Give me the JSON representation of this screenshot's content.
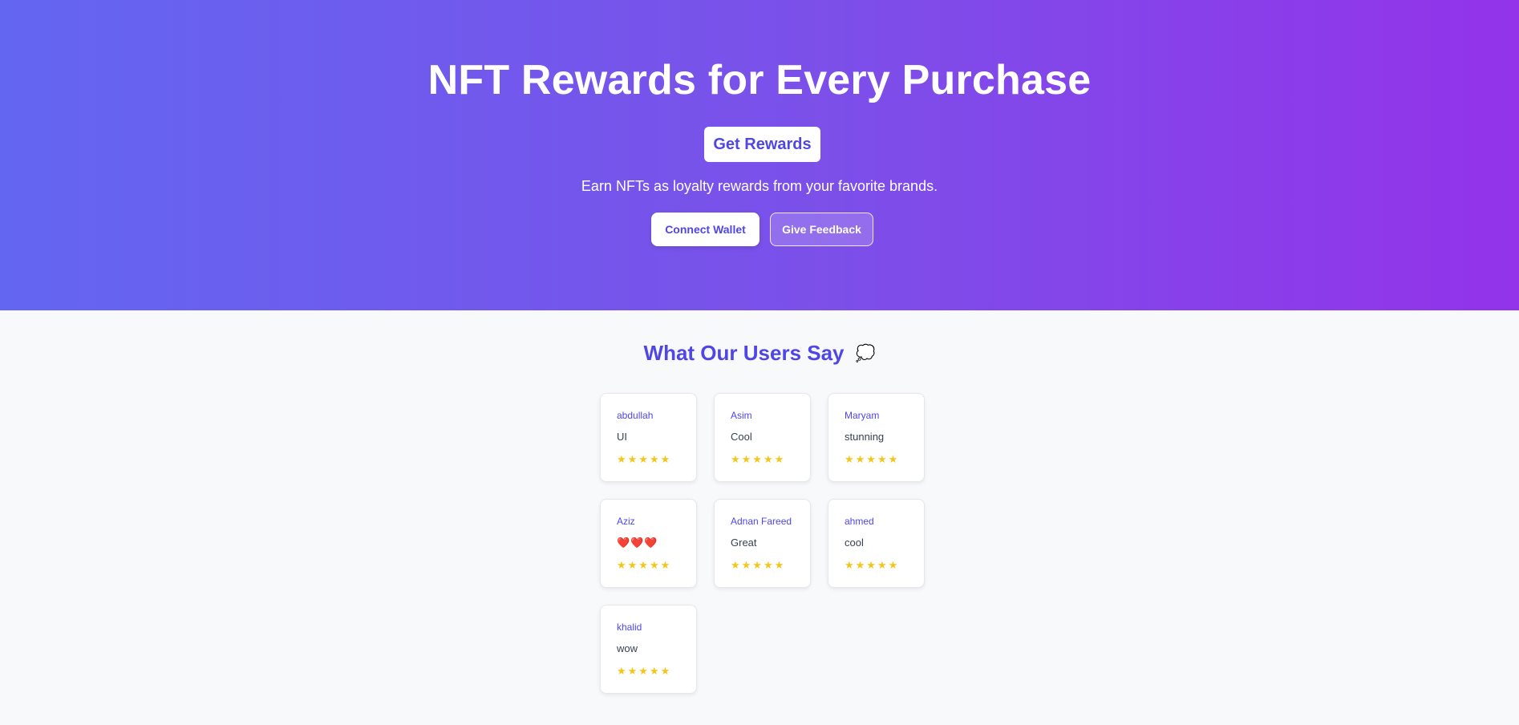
{
  "hero": {
    "title": "NFT Rewards for Every Purchase",
    "get_rewards_label": "Get Rewards",
    "subtitle": "Earn NFTs as loyalty rewards from your favorite brands.",
    "connect_wallet_label": "Connect Wallet",
    "give_feedback_label": "Give Feedback"
  },
  "testimonials": {
    "title": "What Our Users Say",
    "title_icon": "speech-bubble-icon",
    "title_icon_glyph": "💭",
    "reviews": [
      {
        "name": "abdullah",
        "comment": "UI",
        "rating": 5,
        "stars": "★★★★★"
      },
      {
        "name": "Asim",
        "comment": "Cool",
        "rating": 5,
        "stars": "★★★★★"
      },
      {
        "name": "Maryam",
        "comment": "stunning",
        "rating": 5,
        "stars": "★★★★★"
      },
      {
        "name": "Aziz",
        "comment": "❤️❤️❤️",
        "rating": 5,
        "stars": "★★★★★"
      },
      {
        "name": "Adnan Fareed",
        "comment": "Great",
        "rating": 5,
        "stars": "★★★★★"
      },
      {
        "name": "ahmed",
        "comment": "cool",
        "rating": 5,
        "stars": "★★★★★"
      },
      {
        "name": "khalid",
        "comment": "wow",
        "rating": 5,
        "stars": "★★★★★"
      }
    ]
  },
  "colors": {
    "gradient_start": "#6366f1",
    "gradient_end": "#9333ea",
    "accent": "#4f46e5",
    "star": "#f5c518",
    "page_background": "#f8f9fb"
  }
}
